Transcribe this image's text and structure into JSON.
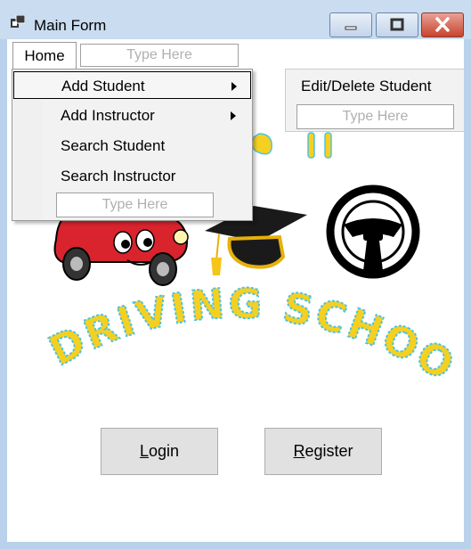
{
  "window": {
    "title": "Main Form",
    "buttons": {
      "minimize": "minimize",
      "maximize": "maximize",
      "close": "close"
    }
  },
  "menu": {
    "home_label": "Home",
    "type_here": "Type Here",
    "home_items": [
      {
        "label": "Add Student",
        "has_submenu": true,
        "highlighted": true
      },
      {
        "label": "Add Instructor",
        "has_submenu": true,
        "highlighted": false
      },
      {
        "label": "Search Student",
        "has_submenu": false,
        "highlighted": false
      },
      {
        "label": "Search Instructor",
        "has_submenu": false,
        "highlighted": false
      }
    ],
    "submenu_items": [
      {
        "label": "Edit/Delete Student"
      }
    ]
  },
  "logo": {
    "text": "DRIVING SCHOOL",
    "colors": {
      "letters": "#f5d020",
      "outline": "#4fc3e0",
      "car": "#d9232d",
      "cap": "#1a1a1a"
    }
  },
  "buttons": {
    "login_label": "Login",
    "register_label": "Register"
  }
}
